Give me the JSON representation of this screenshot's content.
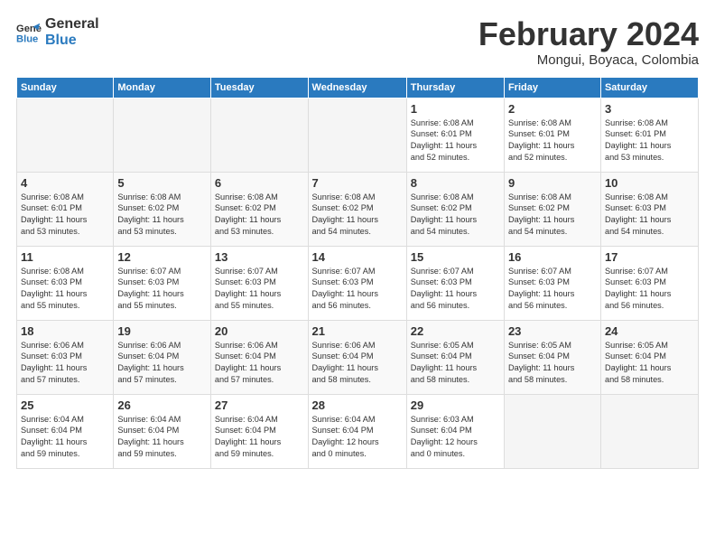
{
  "logo": {
    "line1": "General",
    "line2": "Blue"
  },
  "title": "February 2024",
  "subtitle": "Mongui, Boyaca, Colombia",
  "days_of_week": [
    "Sunday",
    "Monday",
    "Tuesday",
    "Wednesday",
    "Thursday",
    "Friday",
    "Saturday"
  ],
  "weeks": [
    [
      {
        "day": "",
        "info": ""
      },
      {
        "day": "",
        "info": ""
      },
      {
        "day": "",
        "info": ""
      },
      {
        "day": "",
        "info": ""
      },
      {
        "day": "1",
        "info": "Sunrise: 6:08 AM\nSunset: 6:01 PM\nDaylight: 11 hours\nand 52 minutes."
      },
      {
        "day": "2",
        "info": "Sunrise: 6:08 AM\nSunset: 6:01 PM\nDaylight: 11 hours\nand 52 minutes."
      },
      {
        "day": "3",
        "info": "Sunrise: 6:08 AM\nSunset: 6:01 PM\nDaylight: 11 hours\nand 53 minutes."
      }
    ],
    [
      {
        "day": "4",
        "info": "Sunrise: 6:08 AM\nSunset: 6:01 PM\nDaylight: 11 hours\nand 53 minutes."
      },
      {
        "day": "5",
        "info": "Sunrise: 6:08 AM\nSunset: 6:02 PM\nDaylight: 11 hours\nand 53 minutes."
      },
      {
        "day": "6",
        "info": "Sunrise: 6:08 AM\nSunset: 6:02 PM\nDaylight: 11 hours\nand 53 minutes."
      },
      {
        "day": "7",
        "info": "Sunrise: 6:08 AM\nSunset: 6:02 PM\nDaylight: 11 hours\nand 54 minutes."
      },
      {
        "day": "8",
        "info": "Sunrise: 6:08 AM\nSunset: 6:02 PM\nDaylight: 11 hours\nand 54 minutes."
      },
      {
        "day": "9",
        "info": "Sunrise: 6:08 AM\nSunset: 6:02 PM\nDaylight: 11 hours\nand 54 minutes."
      },
      {
        "day": "10",
        "info": "Sunrise: 6:08 AM\nSunset: 6:03 PM\nDaylight: 11 hours\nand 54 minutes."
      }
    ],
    [
      {
        "day": "11",
        "info": "Sunrise: 6:08 AM\nSunset: 6:03 PM\nDaylight: 11 hours\nand 55 minutes."
      },
      {
        "day": "12",
        "info": "Sunrise: 6:07 AM\nSunset: 6:03 PM\nDaylight: 11 hours\nand 55 minutes."
      },
      {
        "day": "13",
        "info": "Sunrise: 6:07 AM\nSunset: 6:03 PM\nDaylight: 11 hours\nand 55 minutes."
      },
      {
        "day": "14",
        "info": "Sunrise: 6:07 AM\nSunset: 6:03 PM\nDaylight: 11 hours\nand 56 minutes."
      },
      {
        "day": "15",
        "info": "Sunrise: 6:07 AM\nSunset: 6:03 PM\nDaylight: 11 hours\nand 56 minutes."
      },
      {
        "day": "16",
        "info": "Sunrise: 6:07 AM\nSunset: 6:03 PM\nDaylight: 11 hours\nand 56 minutes."
      },
      {
        "day": "17",
        "info": "Sunrise: 6:07 AM\nSunset: 6:03 PM\nDaylight: 11 hours\nand 56 minutes."
      }
    ],
    [
      {
        "day": "18",
        "info": "Sunrise: 6:06 AM\nSunset: 6:03 PM\nDaylight: 11 hours\nand 57 minutes."
      },
      {
        "day": "19",
        "info": "Sunrise: 6:06 AM\nSunset: 6:04 PM\nDaylight: 11 hours\nand 57 minutes."
      },
      {
        "day": "20",
        "info": "Sunrise: 6:06 AM\nSunset: 6:04 PM\nDaylight: 11 hours\nand 57 minutes."
      },
      {
        "day": "21",
        "info": "Sunrise: 6:06 AM\nSunset: 6:04 PM\nDaylight: 11 hours\nand 58 minutes."
      },
      {
        "day": "22",
        "info": "Sunrise: 6:05 AM\nSunset: 6:04 PM\nDaylight: 11 hours\nand 58 minutes."
      },
      {
        "day": "23",
        "info": "Sunrise: 6:05 AM\nSunset: 6:04 PM\nDaylight: 11 hours\nand 58 minutes."
      },
      {
        "day": "24",
        "info": "Sunrise: 6:05 AM\nSunset: 6:04 PM\nDaylight: 11 hours\nand 58 minutes."
      }
    ],
    [
      {
        "day": "25",
        "info": "Sunrise: 6:04 AM\nSunset: 6:04 PM\nDaylight: 11 hours\nand 59 minutes."
      },
      {
        "day": "26",
        "info": "Sunrise: 6:04 AM\nSunset: 6:04 PM\nDaylight: 11 hours\nand 59 minutes."
      },
      {
        "day": "27",
        "info": "Sunrise: 6:04 AM\nSunset: 6:04 PM\nDaylight: 11 hours\nand 59 minutes."
      },
      {
        "day": "28",
        "info": "Sunrise: 6:04 AM\nSunset: 6:04 PM\nDaylight: 12 hours\nand 0 minutes."
      },
      {
        "day": "29",
        "info": "Sunrise: 6:03 AM\nSunset: 6:04 PM\nDaylight: 12 hours\nand 0 minutes."
      },
      {
        "day": "",
        "info": ""
      },
      {
        "day": "",
        "info": ""
      }
    ]
  ]
}
